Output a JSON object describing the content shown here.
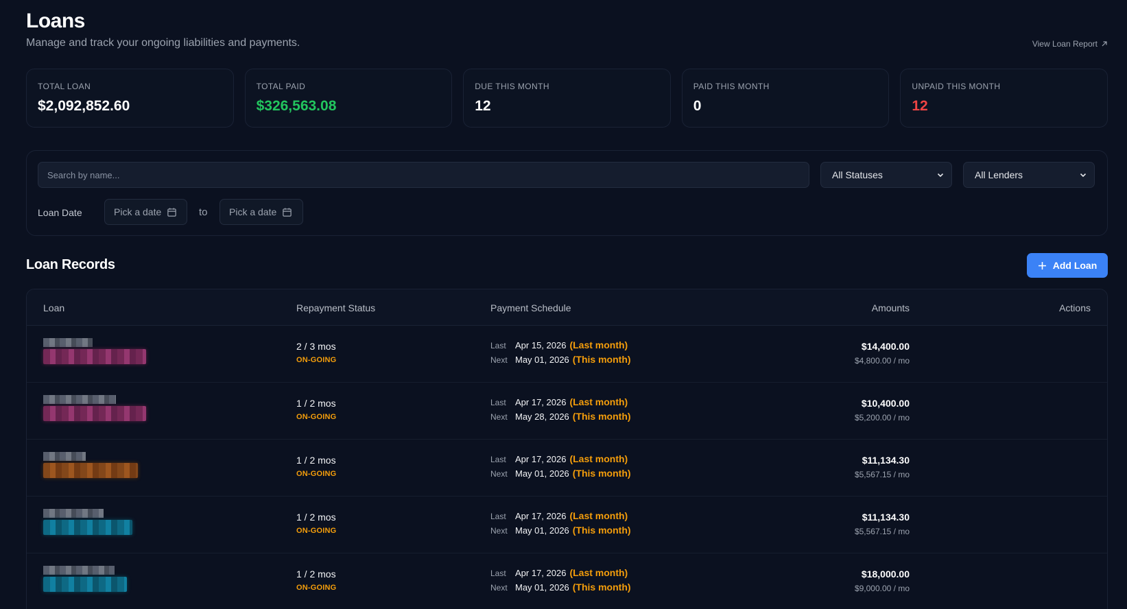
{
  "header": {
    "title": "Loans",
    "subtitle": "Manage and track your ongoing liabilities and payments.",
    "report_link": "View Loan Report"
  },
  "stats": [
    {
      "label": "TOTAL LOAN",
      "value": "$2,092,852.60",
      "color": "#ffffff"
    },
    {
      "label": "TOTAL PAID",
      "value": "$326,563.08",
      "color": "#22c55e"
    },
    {
      "label": "DUE THIS MONTH",
      "value": "12",
      "color": "#ffffff"
    },
    {
      "label": "PAID THIS MONTH",
      "value": "0",
      "color": "#ffffff"
    },
    {
      "label": "UNPAID THIS MONTH",
      "value": "12",
      "color": "#ef4444"
    }
  ],
  "filters": {
    "search_placeholder": "Search by name...",
    "status_select": "All Statuses",
    "lender_select": "All Lenders",
    "date_label": "Loan Date",
    "date_from": "Pick a date",
    "date_to_label": "to",
    "date_to": "Pick a date"
  },
  "records": {
    "title": "Loan Records",
    "add_button": "Add Loan",
    "columns": {
      "loan": "Loan",
      "status": "Repayment Status",
      "schedule": "Payment Schedule",
      "amounts": "Amounts",
      "actions": "Actions"
    },
    "rows": [
      {
        "progress": "2 / 3 mos",
        "status": "ON-GOING",
        "last_key": "Last",
        "last_date": "Apr 15, 2026",
        "last_rel": "(Last month)",
        "next_key": "Next",
        "next_date": "May 01, 2026",
        "next_rel": "(This month)",
        "total": "$14,400.00",
        "monthly": "$4,800.00 / mo"
      },
      {
        "progress": "1 / 2 mos",
        "status": "ON-GOING",
        "last_key": "Last",
        "last_date": "Apr 17, 2026",
        "last_rel": "(Last month)",
        "next_key": "Next",
        "next_date": "May 28, 2026",
        "next_rel": "(This month)",
        "total": "$10,400.00",
        "monthly": "$5,200.00 / mo"
      },
      {
        "progress": "1 / 2 mos",
        "status": "ON-GOING",
        "last_key": "Last",
        "last_date": "Apr 17, 2026",
        "last_rel": "(Last month)",
        "next_key": "Next",
        "next_date": "May 01, 2026",
        "next_rel": "(This month)",
        "total": "$11,134.30",
        "monthly": "$5,567.15 / mo"
      },
      {
        "progress": "1 / 2 mos",
        "status": "ON-GOING",
        "last_key": "Last",
        "last_date": "Apr 17, 2026",
        "last_rel": "(Last month)",
        "next_key": "Next",
        "next_date": "May 01, 2026",
        "next_rel": "(This month)",
        "total": "$11,134.30",
        "monthly": "$5,567.15 / mo"
      },
      {
        "progress": "1 / 2 mos",
        "status": "ON-GOING",
        "last_key": "Last",
        "last_date": "Apr 17, 2026",
        "last_rel": "(Last month)",
        "next_key": "Next",
        "next_date": "May 01, 2026",
        "next_rel": "(This month)",
        "total": "$18,000.00",
        "monthly": "$9,000.00 / mo"
      }
    ]
  },
  "colors": {
    "accent": "#3b82f6",
    "positive": "#22c55e",
    "negative": "#ef4444",
    "warning": "#f59e0b",
    "background": "#0b1120"
  }
}
